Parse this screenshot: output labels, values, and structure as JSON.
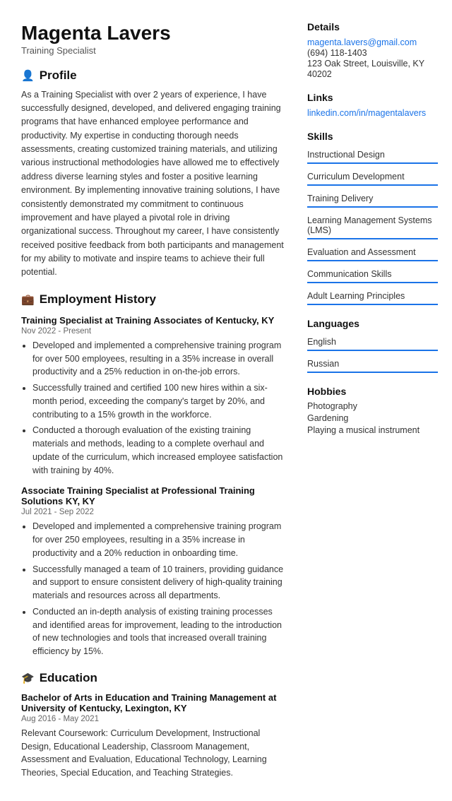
{
  "header": {
    "name": "Magenta Lavers",
    "title": "Training Specialist"
  },
  "profile": {
    "section_label": "Profile",
    "icon": "👤",
    "text": "As a Training Specialist with over 2 years of experience, I have successfully designed, developed, and delivered engaging training programs that have enhanced employee performance and productivity. My expertise in conducting thorough needs assessments, creating customized training materials, and utilizing various instructional methodologies have allowed me to effectively address diverse learning styles and foster a positive learning environment. By implementing innovative training solutions, I have consistently demonstrated my commitment to continuous improvement and have played a pivotal role in driving organizational success. Throughout my career, I have consistently received positive feedback from both participants and management for my ability to motivate and inspire teams to achieve their full potential."
  },
  "employment": {
    "section_label": "Employment History",
    "icon": "💼",
    "jobs": [
      {
        "title": "Training Specialist at Training Associates of Kentucky, KY",
        "dates": "Nov 2022 - Present",
        "bullets": [
          "Developed and implemented a comprehensive training program for over 500 employees, resulting in a 35% increase in overall productivity and a 25% reduction in on-the-job errors.",
          "Successfully trained and certified 100 new hires within a six-month period, exceeding the company's target by 20%, and contributing to a 15% growth in the workforce.",
          "Conducted a thorough evaluation of the existing training materials and methods, leading to a complete overhaul and update of the curriculum, which increased employee satisfaction with training by 40%."
        ]
      },
      {
        "title": "Associate Training Specialist at Professional Training Solutions KY, KY",
        "dates": "Jul 2021 - Sep 2022",
        "bullets": [
          "Developed and implemented a comprehensive training program for over 250 employees, resulting in a 35% increase in productivity and a 20% reduction in onboarding time.",
          "Successfully managed a team of 10 trainers, providing guidance and support to ensure consistent delivery of high-quality training materials and resources across all departments.",
          "Conducted an in-depth analysis of existing training processes and identified areas for improvement, leading to the introduction of new technologies and tools that increased overall training efficiency by 15%."
        ]
      }
    ]
  },
  "education": {
    "section_label": "Education",
    "icon": "🎓",
    "entries": [
      {
        "title": "Bachelor of Arts in Education and Training Management at University of Kentucky, Lexington, KY",
        "dates": "Aug 2016 - May 2021",
        "text": "Relevant Coursework: Curriculum Development, Instructional Design, Educational Leadership, Classroom Management, Assessment and Evaluation, Educational Technology, Learning Theories, Special Education, and Teaching Strategies."
      }
    ]
  },
  "details": {
    "section_label": "Details",
    "email": "magenta.lavers@gmail.com",
    "phone": "(694) 118-1403",
    "address": "123 Oak Street, Louisville, KY 40202"
  },
  "links": {
    "section_label": "Links",
    "items": [
      {
        "label": "linkedin.com/in/magentalavers",
        "url": "#"
      }
    ]
  },
  "skills": {
    "section_label": "Skills",
    "items": [
      "Instructional Design",
      "Curriculum Development",
      "Training Delivery",
      "Learning Management Systems (LMS)",
      "Evaluation and Assessment",
      "Communication Skills",
      "Adult Learning Principles"
    ]
  },
  "languages": {
    "section_label": "Languages",
    "items": [
      "English",
      "Russian"
    ]
  },
  "hobbies": {
    "section_label": "Hobbies",
    "items": [
      "Photography",
      "Gardening",
      "Playing a musical instrument"
    ]
  }
}
